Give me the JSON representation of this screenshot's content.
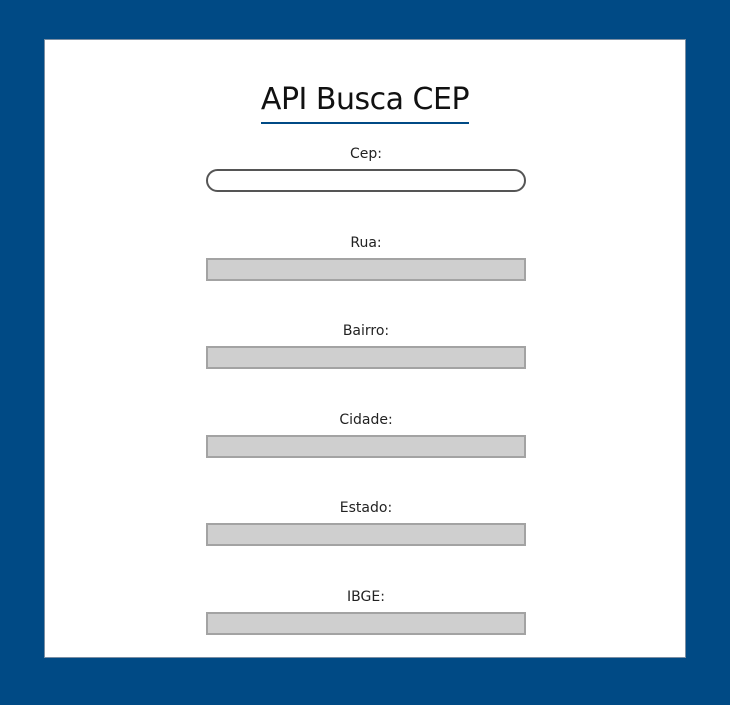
{
  "app": {
    "title": "API Busca CEP"
  },
  "form": {
    "cep": {
      "label": "Cep:",
      "value": ""
    },
    "rua": {
      "label": "Rua:",
      "value": ""
    },
    "bairro": {
      "label": "Bairro:",
      "value": ""
    },
    "cidade": {
      "label": "Cidade:",
      "value": ""
    },
    "estado": {
      "label": "Estado:",
      "value": ""
    },
    "ibge": {
      "label": "IBGE:",
      "value": ""
    }
  },
  "colors": {
    "background": "#004a85",
    "card": "#ffffff",
    "title_underline": "#004a85",
    "readonly_field": "#cfcfcf"
  }
}
